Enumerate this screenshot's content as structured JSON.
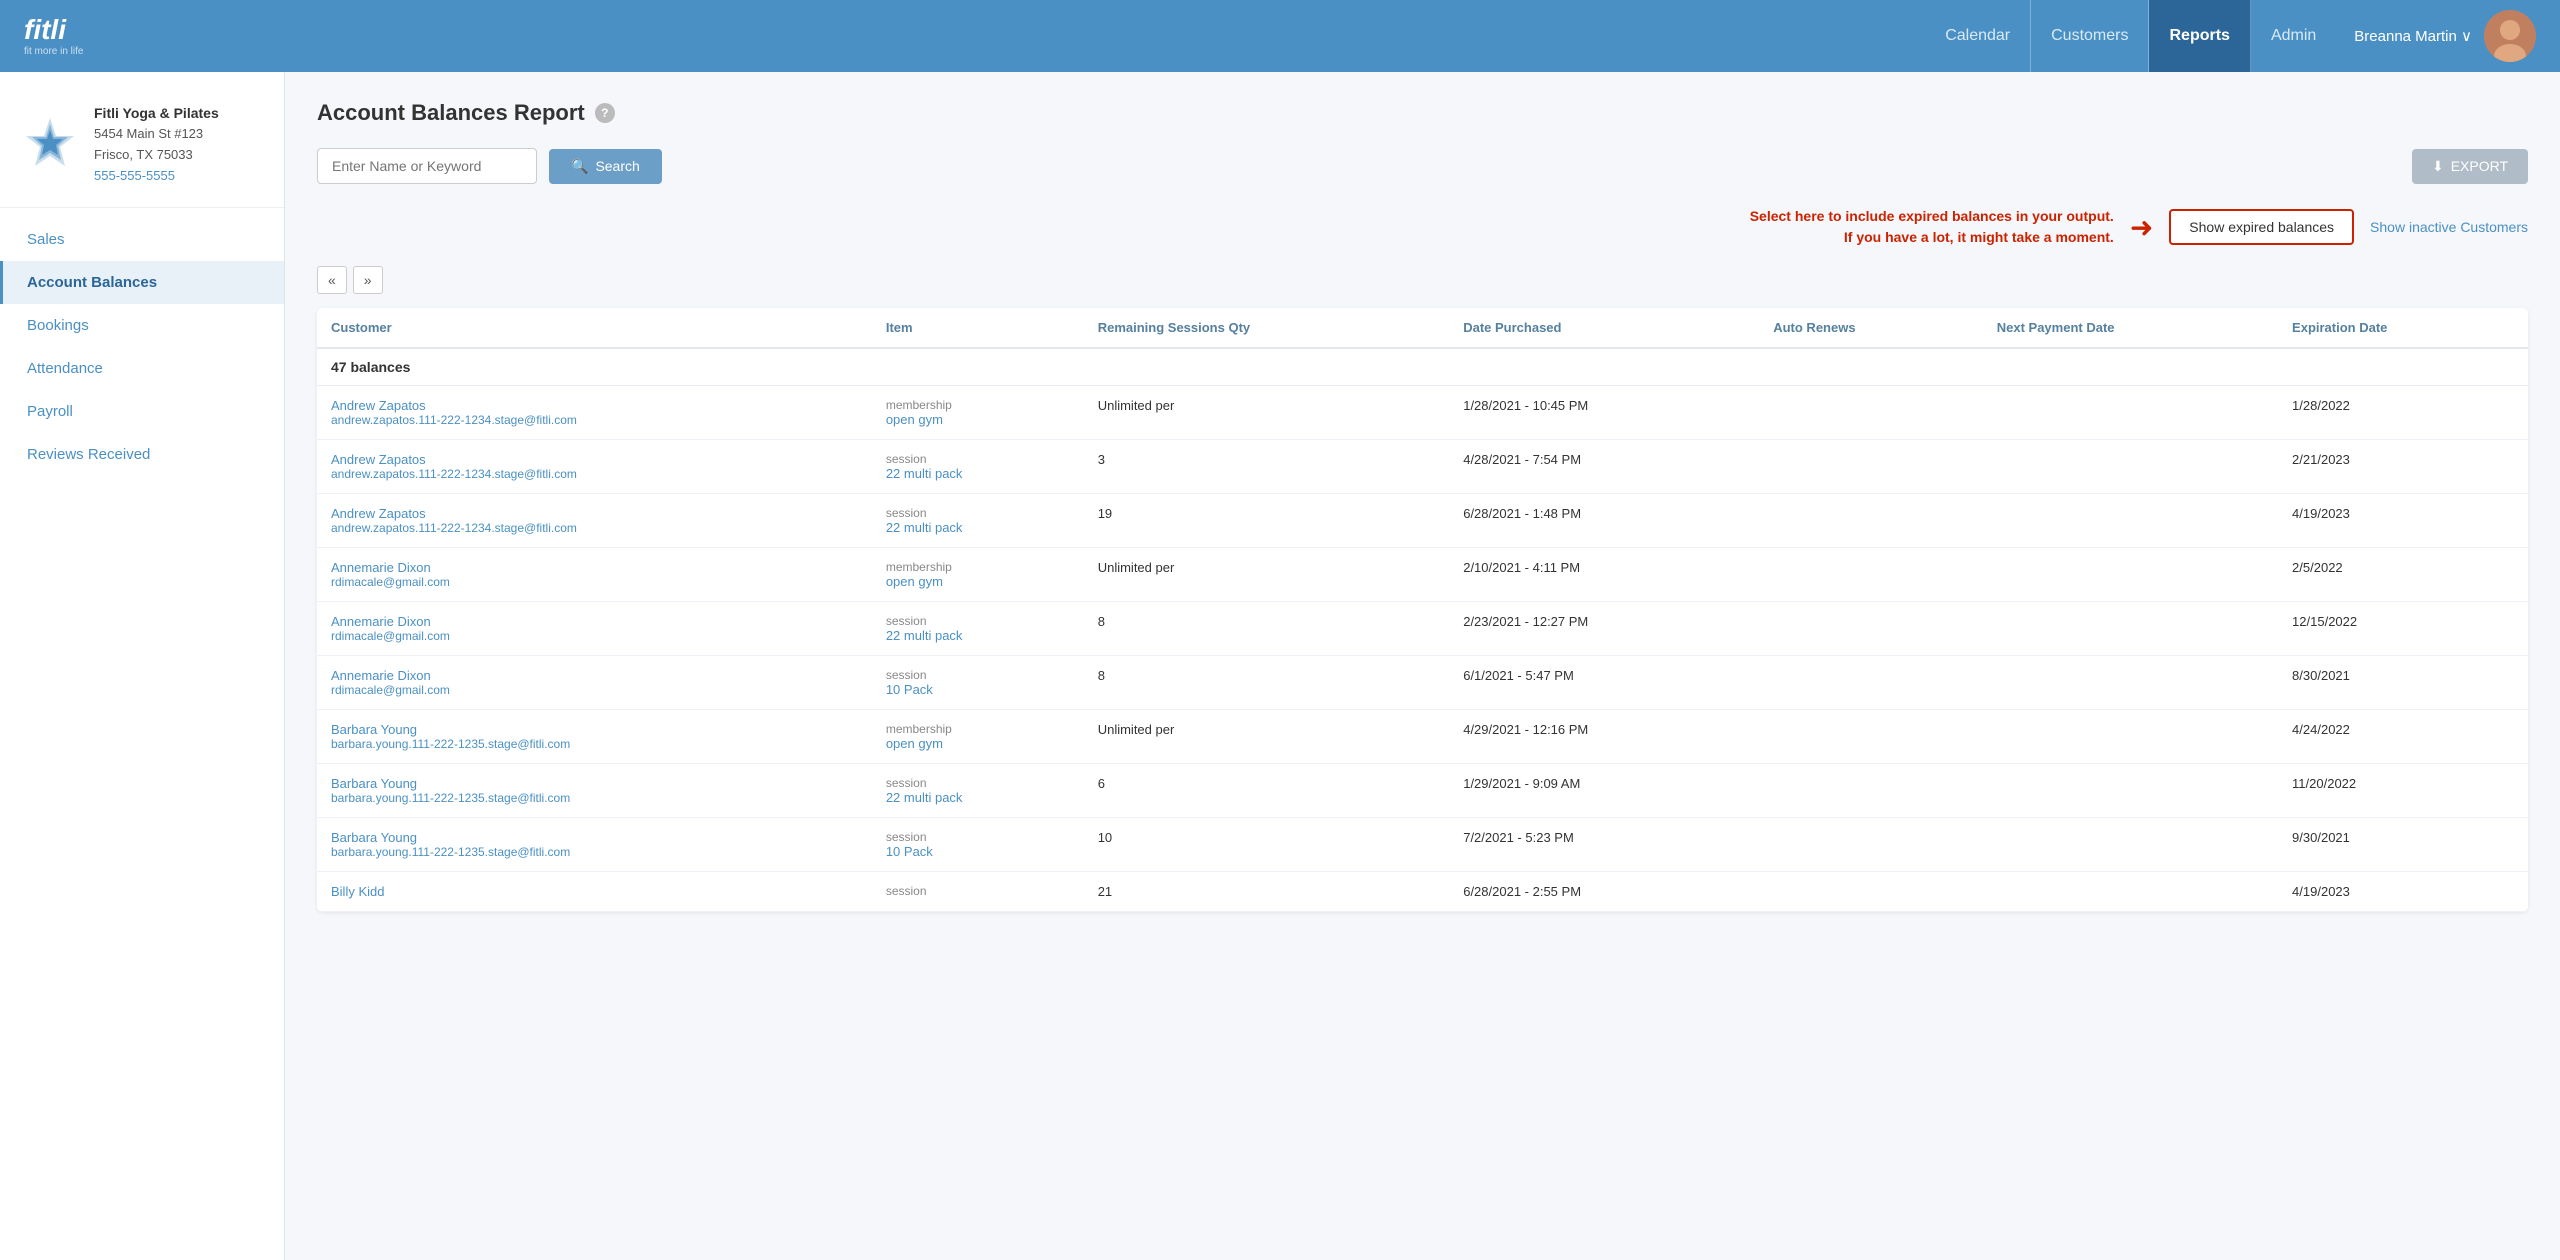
{
  "app": {
    "logo_text": "fitli",
    "logo_sub": "fit more in life"
  },
  "topnav": {
    "links": [
      {
        "id": "calendar",
        "label": "Calendar",
        "active": false
      },
      {
        "id": "customers",
        "label": "Customers",
        "active": false
      },
      {
        "id": "reports",
        "label": "Reports",
        "active": true
      },
      {
        "id": "admin",
        "label": "Admin",
        "active": false
      }
    ],
    "user_name": "Breanna Martin ∨"
  },
  "sidebar": {
    "brand_name": "Fitli Yoga & Pilates",
    "brand_address1": "5454 Main St #123",
    "brand_address2": "Frisco, TX 75033",
    "brand_phone": "555-555-5555",
    "nav_items": [
      {
        "id": "sales",
        "label": "Sales",
        "active": false
      },
      {
        "id": "account-balances",
        "label": "Account Balances",
        "active": true
      },
      {
        "id": "bookings",
        "label": "Bookings",
        "active": false
      },
      {
        "id": "attendance",
        "label": "Attendance",
        "active": false
      },
      {
        "id": "payroll",
        "label": "Payroll",
        "active": false
      },
      {
        "id": "reviews-received",
        "label": "Reviews Received",
        "active": false
      }
    ]
  },
  "page": {
    "title": "Account Balances Report",
    "help_icon": "?",
    "search_placeholder": "Enter Name or Keyword",
    "search_label": "Search",
    "export_label": "EXPORT",
    "callout_text": "Select here to include expired balances in your output. If you have a lot, it might take a moment.",
    "show_expired_label": "Show expired balances",
    "show_inactive_label": "Show inactive Customers",
    "balance_count": "47 balances"
  },
  "table": {
    "columns": [
      {
        "id": "customer",
        "label": "Customer"
      },
      {
        "id": "item",
        "label": "Item"
      },
      {
        "id": "remaining-sessions",
        "label": "Remaining Sessions Qty"
      },
      {
        "id": "date-purchased",
        "label": "Date Purchased"
      },
      {
        "id": "auto-renews",
        "label": "Auto Renews"
      },
      {
        "id": "next-payment-date",
        "label": "Next Payment Date"
      },
      {
        "id": "expiration-date",
        "label": "Expiration Date"
      }
    ],
    "rows": [
      {
        "customer_name": "Andrew Zapatos",
        "customer_email": "andrew.zapatos.111-222-1234.stage@fitli.com",
        "item_type": "membership",
        "item_name": "open gym",
        "remaining_qty": "Unlimited per",
        "date_purchased": "1/28/2021 - 10:45 PM",
        "auto_renews": "",
        "next_payment_date": "",
        "expiration_date": "1/28/2022"
      },
      {
        "customer_name": "Andrew Zapatos",
        "customer_email": "andrew.zapatos.111-222-1234.stage@fitli.com",
        "item_type": "session",
        "item_name": "22 multi pack",
        "remaining_qty": "3",
        "date_purchased": "4/28/2021 - 7:54 PM",
        "auto_renews": "",
        "next_payment_date": "",
        "expiration_date": "2/21/2023"
      },
      {
        "customer_name": "Andrew Zapatos",
        "customer_email": "andrew.zapatos.111-222-1234.stage@fitli.com",
        "item_type": "session",
        "item_name": "22 multi pack",
        "remaining_qty": "19",
        "date_purchased": "6/28/2021 - 1:48 PM",
        "auto_renews": "",
        "next_payment_date": "",
        "expiration_date": "4/19/2023"
      },
      {
        "customer_name": "Annemarie Dixon",
        "customer_email": "rdimacale@gmail.com",
        "item_type": "membership",
        "item_name": "open gym",
        "remaining_qty": "Unlimited per",
        "date_purchased": "2/10/2021 - 4:11 PM",
        "auto_renews": "",
        "next_payment_date": "",
        "expiration_date": "2/5/2022"
      },
      {
        "customer_name": "Annemarie Dixon",
        "customer_email": "rdimacale@gmail.com",
        "item_type": "session",
        "item_name": "22 multi pack",
        "remaining_qty": "8",
        "date_purchased": "2/23/2021 - 12:27 PM",
        "auto_renews": "",
        "next_payment_date": "",
        "expiration_date": "12/15/2022"
      },
      {
        "customer_name": "Annemarie Dixon",
        "customer_email": "rdimacale@gmail.com",
        "item_type": "session",
        "item_name": "10 Pack",
        "remaining_qty": "8",
        "date_purchased": "6/1/2021 - 5:47 PM",
        "auto_renews": "",
        "next_payment_date": "",
        "expiration_date": "8/30/2021"
      },
      {
        "customer_name": "Barbara Young",
        "customer_email": "barbara.young.111-222-1235.stage@fitli.com",
        "item_type": "membership",
        "item_name": "open gym",
        "remaining_qty": "Unlimited per",
        "date_purchased": "4/29/2021 - 12:16 PM",
        "auto_renews": "",
        "next_payment_date": "",
        "expiration_date": "4/24/2022"
      },
      {
        "customer_name": "Barbara Young",
        "customer_email": "barbara.young.111-222-1235.stage@fitli.com",
        "item_type": "session",
        "item_name": "22 multi pack",
        "remaining_qty": "6",
        "date_purchased": "1/29/2021 - 9:09 AM",
        "auto_renews": "",
        "next_payment_date": "",
        "expiration_date": "11/20/2022"
      },
      {
        "customer_name": "Barbara Young",
        "customer_email": "barbara.young.111-222-1235.stage@fitli.com",
        "item_type": "session",
        "item_name": "10 Pack",
        "remaining_qty": "10",
        "date_purchased": "7/2/2021 - 5:23 PM",
        "auto_renews": "",
        "next_payment_date": "",
        "expiration_date": "9/30/2021"
      },
      {
        "customer_name": "Billy Kidd",
        "customer_email": "",
        "item_type": "session",
        "item_name": "",
        "remaining_qty": "21",
        "date_purchased": "6/28/2021 - 2:55 PM",
        "auto_renews": "",
        "next_payment_date": "",
        "expiration_date": "4/19/2023"
      }
    ]
  }
}
